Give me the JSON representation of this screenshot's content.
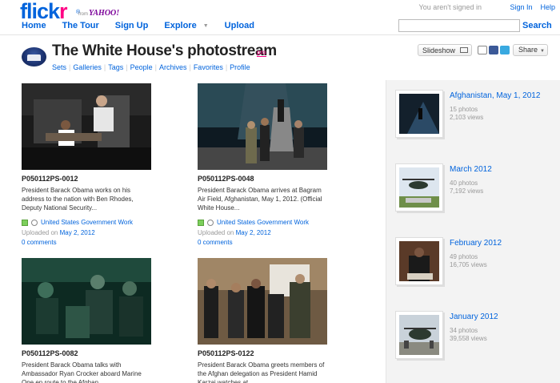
{
  "header": {
    "logo_text_blue": "flick",
    "logo_text_pink": "r",
    "logo_reg": "®",
    "from_text": "from",
    "yahoo_text": "YAHOO!",
    "nav": [
      {
        "label": "Home"
      },
      {
        "label": "The Tour"
      },
      {
        "label": "Sign Up"
      },
      {
        "label": "Explore"
      },
      {
        "label": "Upload"
      }
    ],
    "signed_in_text": "You aren't signed in",
    "sign_in_label": "Sign In",
    "help_label": "Help",
    "search_value": "",
    "search_label": "Search"
  },
  "profile": {
    "title": "The White House's photostream",
    "pro_badge": "pro",
    "subnav": [
      "Sets",
      "Galleries",
      "Tags",
      "People",
      "Archives",
      "Favorites",
      "Profile"
    ],
    "slideshow_label": "Slideshow",
    "share_label": "Share"
  },
  "photos": [
    {
      "id": "P050112PS-0012",
      "description": "President Barack Obama works on his address to the nation with Ben Rhodes, Deputy National Security...",
      "license": "United States Government Work",
      "uploaded_label": "Uploaded on",
      "uploaded_date": "May 2, 2012",
      "comments": "0 comments"
    },
    {
      "id": "P050112PS-0048",
      "description": "President Barack Obama arrives at Bagram Air Field, Afghanistan, May 1, 2012. (Official White House...",
      "license": "United States Government Work",
      "uploaded_label": "Uploaded on",
      "uploaded_date": "May 2, 2012",
      "comments": "0 comments"
    },
    {
      "id": "P050112PS-0082",
      "description": "President Barack Obama talks with Ambassador Ryan Crocker aboard Marine One en route to the Afghan..."
    },
    {
      "id": "P050112PS-0122",
      "description": "President Barack Obama greets members of the Afghan delegation as President Hamid Karzai watches at..."
    }
  ],
  "sets": [
    {
      "title": "Afghanistan, May 1, 2012",
      "count": "15 photos",
      "views": "2,103 views"
    },
    {
      "title": "March 2012",
      "count": "40 photos",
      "views": "7,192 views"
    },
    {
      "title": "February 2012",
      "count": "49 photos",
      "views": "16,705 views"
    },
    {
      "title": "January 2012",
      "count": "34 photos",
      "views": "39,558 views"
    }
  ]
}
